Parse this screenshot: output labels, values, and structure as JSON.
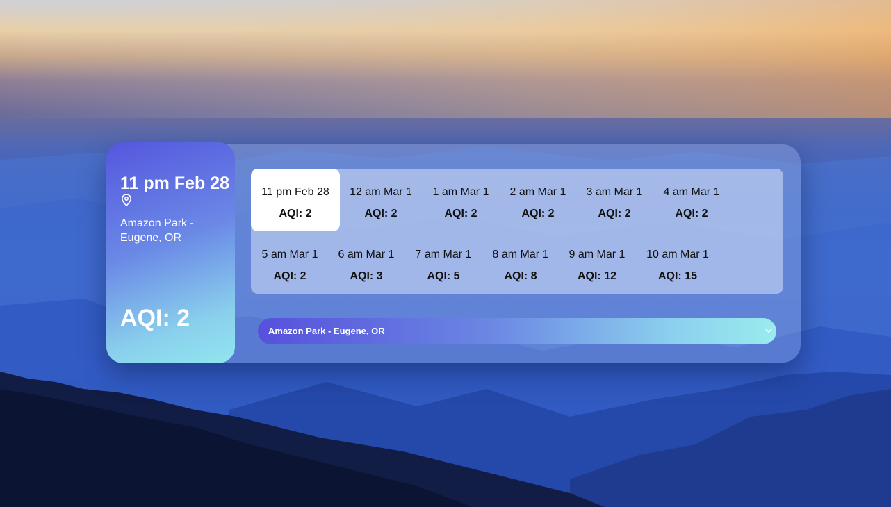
{
  "theme": {
    "accent_start": "#5557DE",
    "accent_end": "#90E6EF",
    "selected_bg": "#FFFFFF"
  },
  "current": {
    "time": "11 pm Feb 28",
    "location": "Amazon Park - Eugene, OR",
    "aqi": "AQI: 2",
    "location_icon": "map-pin-icon"
  },
  "forecast": [
    {
      "time": "11 pm Feb 28",
      "aqi": "AQI: 2",
      "selected": true
    },
    {
      "time": "12 am Mar 1",
      "aqi": "AQI: 2",
      "selected": false
    },
    {
      "time": "1 am Mar 1",
      "aqi": "AQI: 2",
      "selected": false
    },
    {
      "time": "2 am Mar 1",
      "aqi": "AQI: 2",
      "selected": false
    },
    {
      "time": "3 am Mar 1",
      "aqi": "AQI: 2",
      "selected": false
    },
    {
      "time": "4 am Mar 1",
      "aqi": "AQI: 2",
      "selected": false
    },
    {
      "time": "5 am Mar 1",
      "aqi": "AQI: 2",
      "selected": false
    },
    {
      "time": "6 am Mar 1",
      "aqi": "AQI: 3",
      "selected": false
    },
    {
      "time": "7 am Mar 1",
      "aqi": "AQI: 5",
      "selected": false
    },
    {
      "time": "8 am Mar 1",
      "aqi": "AQI: 8",
      "selected": false
    },
    {
      "time": "9 am Mar 1",
      "aqi": "AQI: 12",
      "selected": false
    },
    {
      "time": "10 am Mar 1",
      "aqi": "AQI: 15",
      "selected": false
    }
  ],
  "location_select": {
    "selected": "Amazon Park - Eugene, OR",
    "icon": "chevron-down-icon"
  }
}
